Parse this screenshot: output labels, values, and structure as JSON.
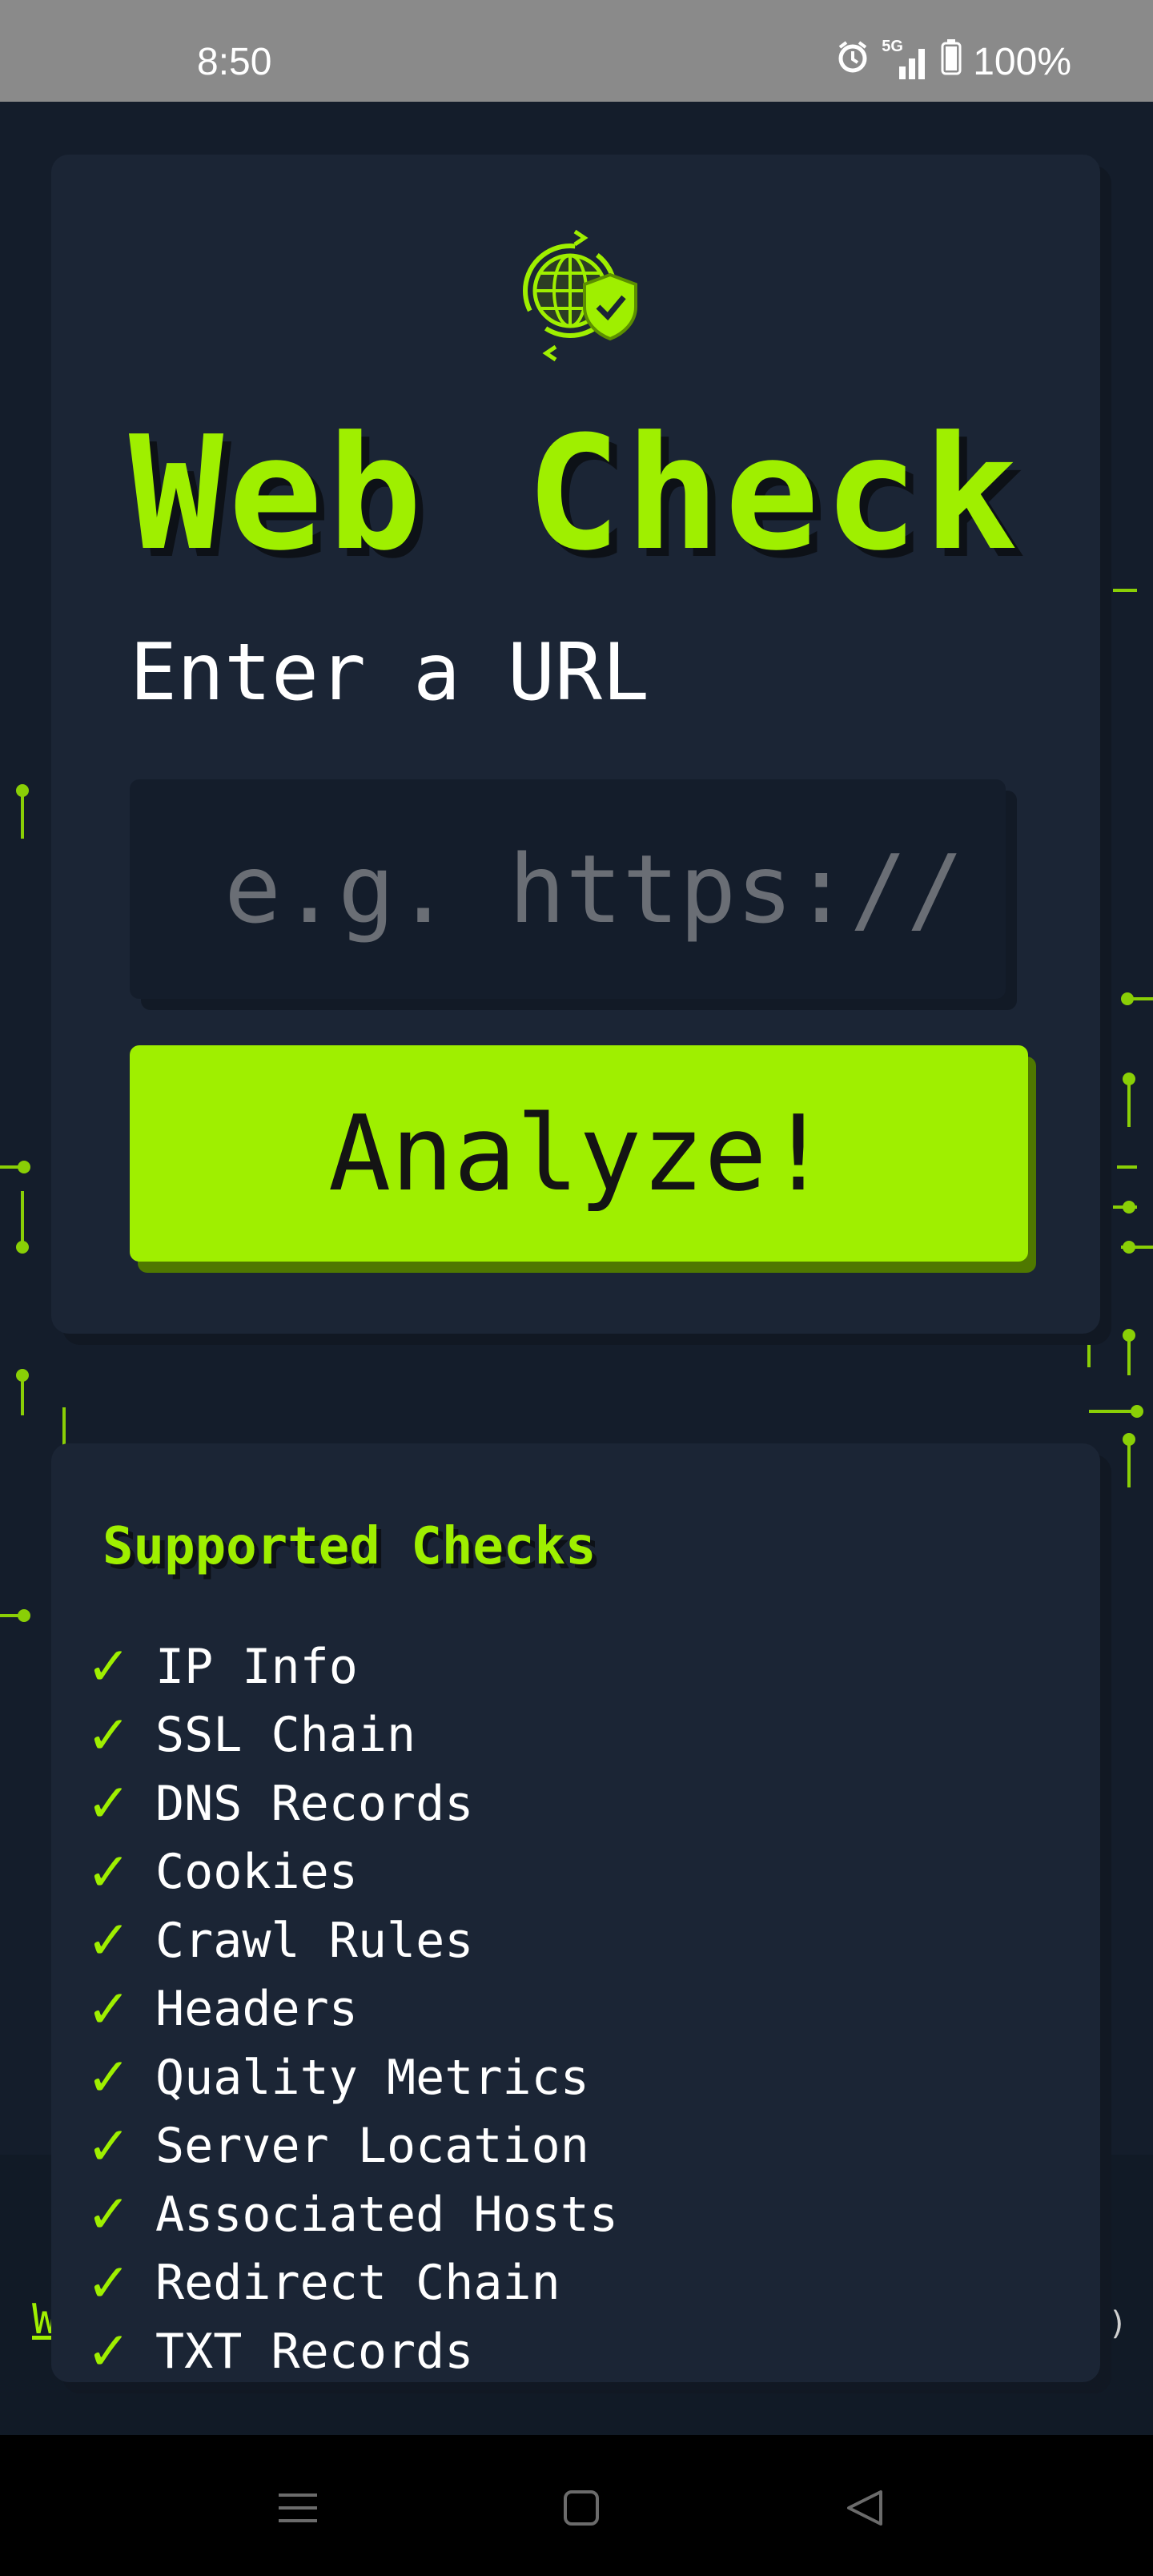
{
  "status_bar": {
    "time": "8:50",
    "network": "5G",
    "battery": "100%"
  },
  "main_card": {
    "logo_icon": "globe-shield-icon",
    "title": "Web Check",
    "subtitle": "Enter a URL",
    "url_input": {
      "placeholder": "e.g. https://",
      "value": ""
    },
    "analyze_label": "Analyze!"
  },
  "checks_card": {
    "heading": "Supported Checks",
    "check_icon": "check-icon",
    "items": [
      "IP Info",
      "SSL Chain",
      "DNS Records",
      "Cookies",
      "Crawl Rules",
      "Headers",
      "Quality Metrics",
      "Server Location",
      "Associated Hosts",
      "Redirect Chain",
      "TXT Records"
    ]
  },
  "footer": {
    "left_fragment": "W",
    "right_fragment": ")"
  },
  "nav_bar": {
    "icons": [
      "menu-icon",
      "home-icon",
      "back-icon"
    ]
  },
  "colors": {
    "accent": "#9fef00",
    "background": "#141d2b",
    "card": "#1b2535",
    "text": "#ffffff"
  }
}
